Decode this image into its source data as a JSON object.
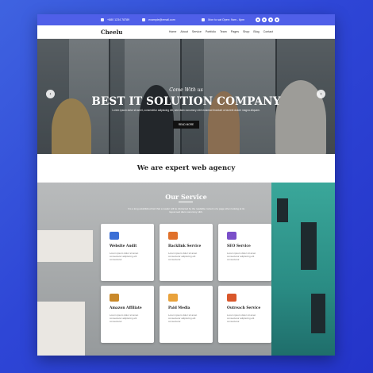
{
  "topbar": {
    "phone": "+880 1234 78789",
    "email": "example@email.com",
    "hours": "Mon to sat Open: 9am - 6pm"
  },
  "nav": {
    "logo": "Cheelu",
    "menu": [
      "Home",
      "About",
      "Service",
      "Portfolio",
      "Team",
      "Pages",
      "Shop",
      "Blog",
      "Contact"
    ]
  },
  "hero": {
    "script": "Come With us",
    "headline": "BEST IT SOLUTION COMPANY",
    "subtext": "Lorem ipsum dolor sit amet, consectetur adipiscing elit, sed diam nonummy nibh euismod tincidunt ut laoreet dolore magna aliquam.",
    "button": "READ MORE",
    "prev_icon": "chevron-left-icon",
    "next_icon": "chevron-right-icon"
  },
  "expert": {
    "title": "We are expert web agency"
  },
  "service": {
    "title": "Our Service",
    "description": "It is a long established fact that a reader will be distracted by the readable content of a page when looking at its layout sed diam nonummy nibh.",
    "cards": [
      {
        "title": "Website Audit",
        "icon": "monitor-icon",
        "color": "#3b6fd6",
        "text": "Lorem ipsum dolor sit amet consectetur adipiscing elit consectetur."
      },
      {
        "title": "Backlink Service",
        "icon": "link-icon",
        "color": "#e0712b",
        "text": "Lorem ipsum dolor sit amet consectetur adipiscing elit consectetur."
      },
      {
        "title": "SEO Service",
        "icon": "seo-icon",
        "color": "#7a4fc9",
        "text": "Lorem ipsum dolor sit amet consectetur adipiscing elit consectetur."
      },
      {
        "title": "Amazon Affiliate",
        "icon": "affiliate-icon",
        "color": "#c9892a",
        "text": "Lorem ipsum dolor sit amet consectetur adipiscing elit consectetur."
      },
      {
        "title": "Paid Media",
        "icon": "media-icon",
        "color": "#e9a23b",
        "text": "Lorem ipsum dolor sit amet consectetur adipiscing elit consectetur."
      },
      {
        "title": "Outreach Service",
        "icon": "outreach-icon",
        "color": "#d9572b",
        "text": "Lorem ipsum dolor sit amet consectetur adipiscing elit consectetur."
      }
    ]
  },
  "colors": {
    "brand": "#4f5fe8",
    "background": "#3448d8"
  }
}
